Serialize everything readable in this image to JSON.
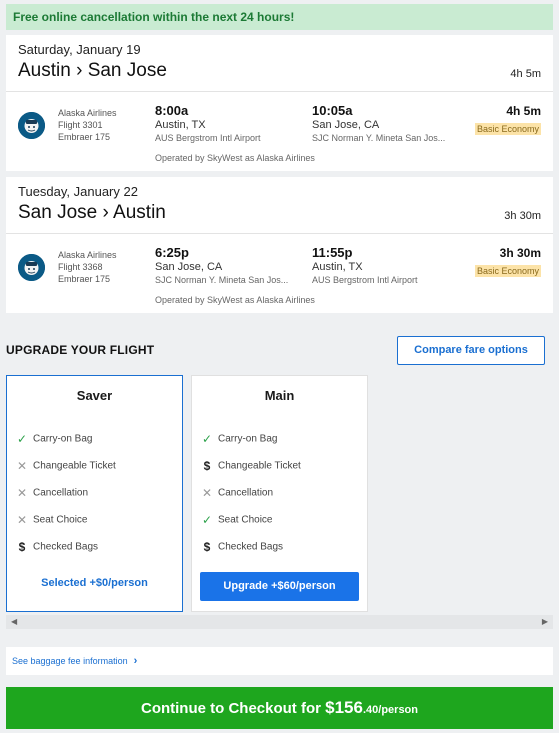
{
  "banner": "Free online cancellation within the next 24 hours!",
  "flights": [
    {
      "date": "Saturday, January 19",
      "route": "Austin › San Jose",
      "duration": "4h 5m",
      "airline": "Alaska Airlines",
      "flight": "Flight 3301",
      "aircraft": "Embraer 175",
      "dep_time": "8:00a",
      "dep_city": "Austin, TX",
      "dep_airport": "AUS Bergstrom Intl Airport",
      "arr_time": "10:05a",
      "arr_city": "San Jose, CA",
      "arr_airport": "SJC Norman Y. Mineta San Jos...",
      "seg_duration": "4h 5m",
      "fare_class": "Basic Economy",
      "operated": "Operated by SkyWest as Alaska Airlines"
    },
    {
      "date": "Tuesday, January 22",
      "route": "San Jose › Austin",
      "duration": "3h 30m",
      "airline": "Alaska Airlines",
      "flight": "Flight 3368",
      "aircraft": "Embraer 175",
      "dep_time": "6:25p",
      "dep_city": "San Jose, CA",
      "dep_airport": "SJC Norman Y. Mineta San Jos...",
      "arr_time": "11:55p",
      "arr_city": "Austin, TX",
      "arr_airport": "AUS Bergstrom Intl Airport",
      "seg_duration": "3h 30m",
      "fare_class": "Basic Economy",
      "operated": "Operated by SkyWest as Alaska Airlines"
    }
  ],
  "upgrade": {
    "title": "UPGRADE YOUR FLIGHT",
    "compare_label": "Compare fare options"
  },
  "fares": [
    {
      "name": "Saver",
      "features": [
        {
          "icon": "check-icon",
          "label": "Carry-on Bag"
        },
        {
          "icon": "x-icon",
          "label": "Changeable Ticket"
        },
        {
          "icon": "x-icon",
          "label": "Cancellation"
        },
        {
          "icon": "x-icon",
          "label": "Seat Choice"
        },
        {
          "icon": "dollar-icon",
          "label": "Checked Bags"
        }
      ],
      "action": "Selected +$0/person"
    },
    {
      "name": "Main",
      "features": [
        {
          "icon": "check-icon",
          "label": "Carry-on Bag"
        },
        {
          "icon": "dollar-icon",
          "label": "Changeable Ticket"
        },
        {
          "icon": "x-icon",
          "label": "Cancellation"
        },
        {
          "icon": "check-icon",
          "label": "Seat Choice"
        },
        {
          "icon": "dollar-icon",
          "label": "Checked Bags"
        }
      ],
      "action": "Upgrade +$60/person"
    }
  ],
  "baggage_link": "See baggage fee information",
  "checkout": {
    "prefix": "Continue to Checkout for ",
    "price_main": "$156",
    "price_cents": ".40",
    "per": "/person"
  },
  "colors": {
    "accent": "#1a73e8",
    "success": "#1ea61e",
    "banner_bg": "#c9ebd2",
    "fare_badge_bg": "#fce3a8"
  }
}
